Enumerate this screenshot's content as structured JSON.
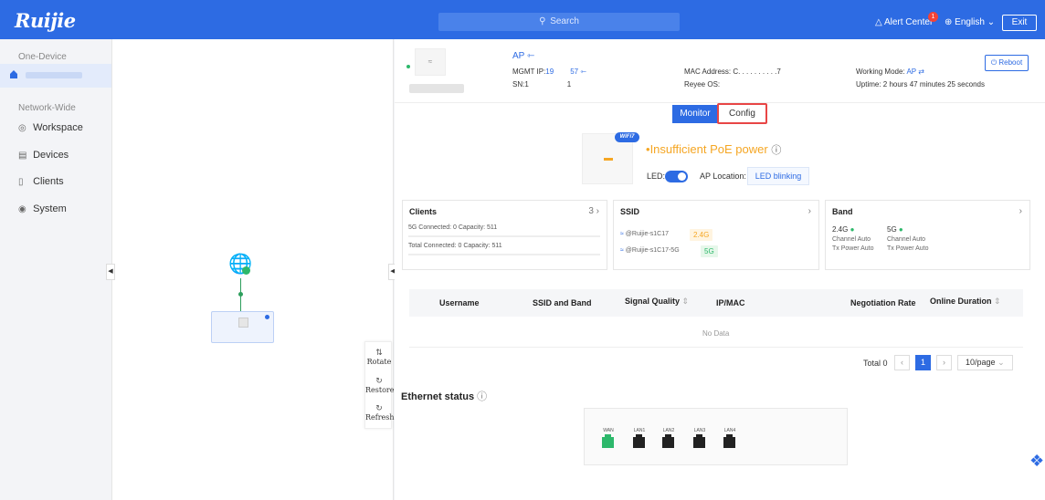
{
  "topbar": {
    "logo": "Ruijie",
    "search": "Search",
    "alert": "Alert Center",
    "alert_count": "1",
    "language": "English",
    "exit": "Exit"
  },
  "sidebar": {
    "one_device": "One-Device",
    "network_wide": "Network-Wide",
    "items": [
      {
        "label": "Workspace",
        "icon": "workspace-icon"
      },
      {
        "label": "Devices",
        "icon": "devices-icon"
      },
      {
        "label": "Clients",
        "icon": "clients-icon"
      },
      {
        "label": "System",
        "icon": "system-icon"
      }
    ]
  },
  "topology": {
    "tools": [
      {
        "label": "Rotate",
        "icon": "rotate-icon"
      },
      {
        "label": "Restore",
        "icon": "restore-icon"
      },
      {
        "label": "Refresh",
        "icon": "refresh-icon"
      }
    ]
  },
  "device": {
    "name": "AP",
    "mgmt_ip_label": "MGMT IP:",
    "mgmt_ip_start": "19",
    "mgmt_ip_end": "57",
    "sn_label": "SN:",
    "sn_start": "1",
    "sn_end": "1",
    "mac_label": "MAC Address:",
    "mac_value": "C. . . . . . . . . .7",
    "os_label": "Reyee OS:",
    "working_mode_label": "Working Mode:",
    "working_mode": "AP",
    "uptime": "Uptime: 2 hours 47 minutes 25 seconds",
    "reboot": "Reboot"
  },
  "tabs": {
    "monitor": "Monitor",
    "config": "Config"
  },
  "ap_status": {
    "badge": "WiFi7",
    "warning": "Insufficient PoE power",
    "led_label": "LED:",
    "location_label": "AP Location:",
    "location_button": "LED blinking"
  },
  "clients_card": {
    "title": "Clients",
    "count": "3",
    "line1": "5G Connected: 0  Capacity: 511",
    "line2": "Total Connected: 0  Capacity: 511"
  },
  "ssid_card": {
    "title": "SSID",
    "ssids": [
      {
        "name": "@Ruijie-s1C17",
        "band": "2.4G"
      },
      {
        "name": "@Ruijie-s1C17-5G",
        "band": "5G"
      }
    ]
  },
  "band_card": {
    "title": "Band",
    "bands": [
      {
        "name": "2.4G",
        "channel": "Channel Auto",
        "power": "Tx Power Auto"
      },
      {
        "name": "5G",
        "channel": "Channel Auto",
        "power": "Tx Power Auto"
      }
    ]
  },
  "table": {
    "headers": [
      "Username",
      "SSID and Band",
      "Signal Quality",
      "IP/MAC",
      "Negotiation Rate",
      "Online Duration"
    ],
    "empty": "No Data"
  },
  "pagination": {
    "total": "Total 0",
    "page": "1",
    "per_page": "10/page"
  },
  "ethernet": {
    "title": "Ethernet status",
    "ports": [
      "WAN",
      "LAN1",
      "LAN2",
      "LAN3",
      "LAN4"
    ]
  }
}
